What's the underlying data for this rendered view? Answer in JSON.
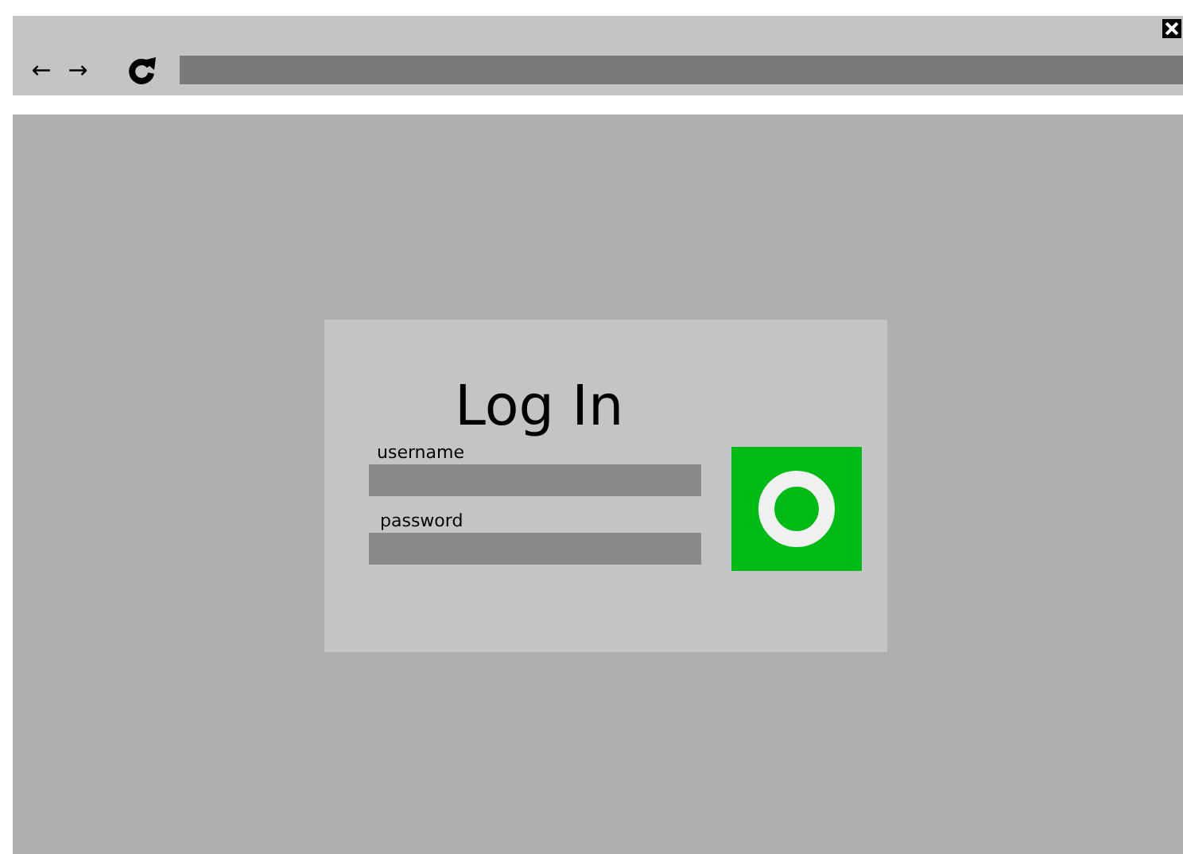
{
  "browser_bar": {
    "back": "←",
    "forward": "→"
  },
  "login": {
    "title": "Log In",
    "fields": [
      {
        "label": "username"
      },
      {
        "label": "password"
      }
    ]
  }
}
